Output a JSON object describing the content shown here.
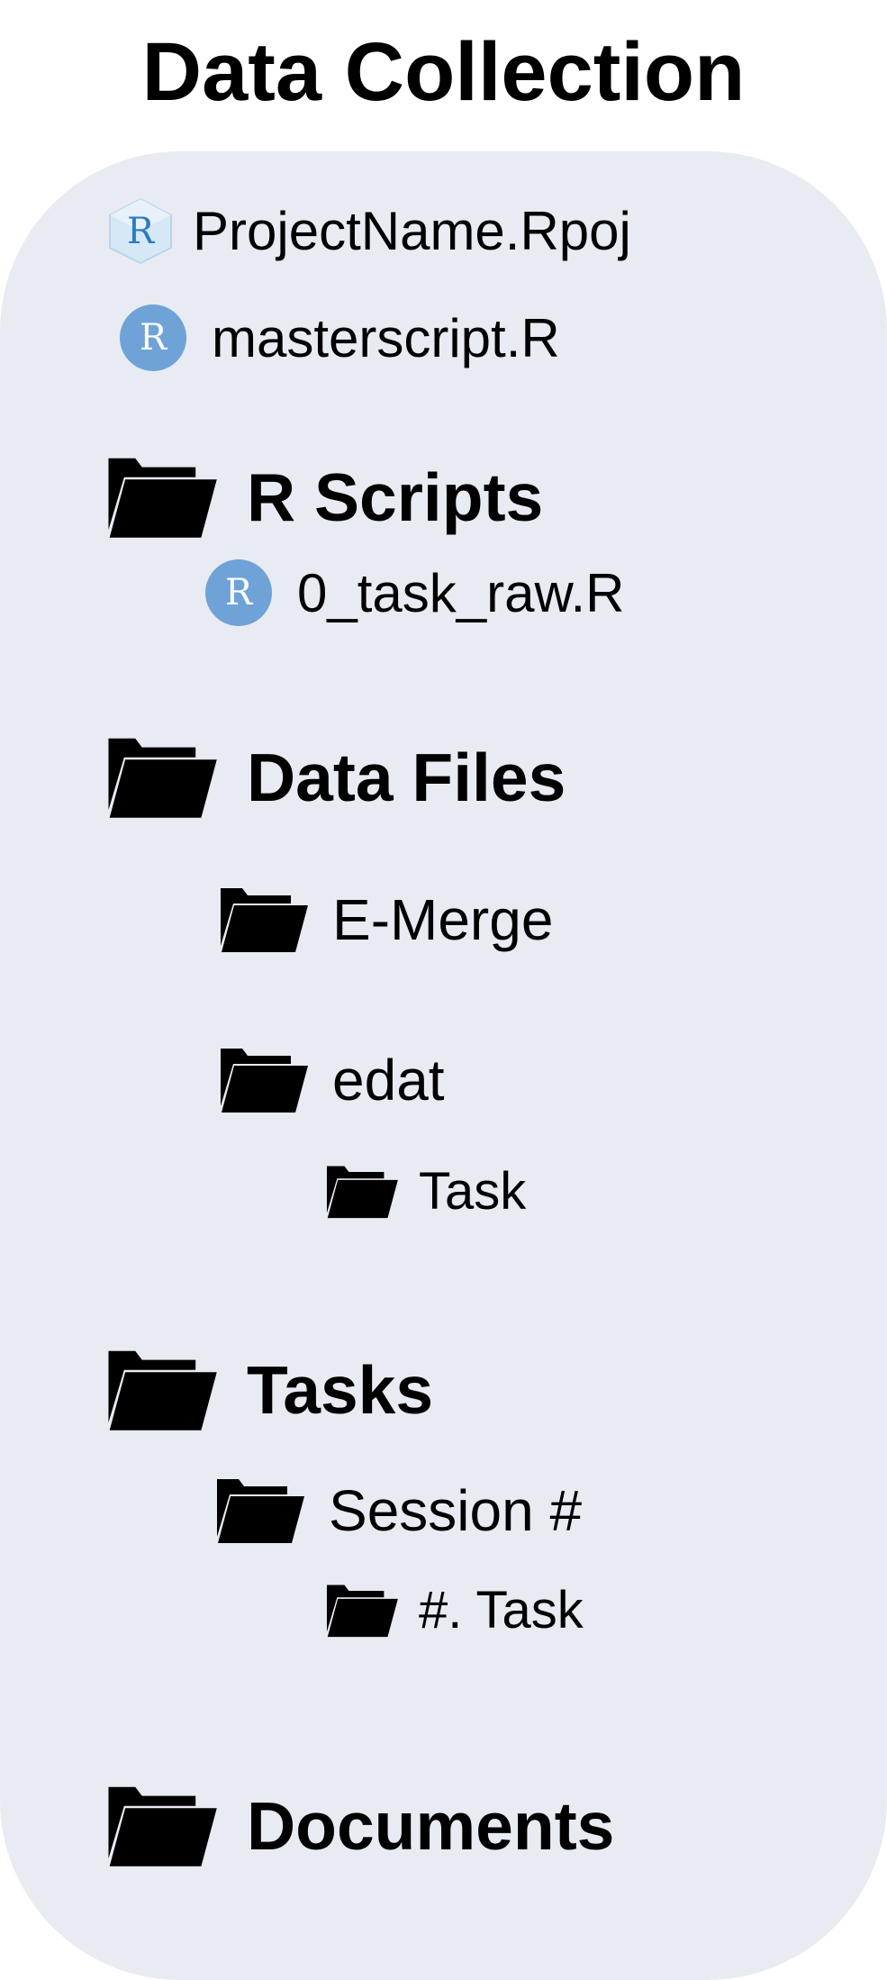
{
  "title": "Data Collection",
  "colors": {
    "panel": "#E8EBF1",
    "r_circle": "#6FA3D8",
    "r_proj_cube": "#CFE3F3",
    "r_proj_letter": "#2C7BC0",
    "text": "#000000"
  },
  "tree": {
    "project_file": {
      "label": "ProjectName.Rpoj",
      "icon": "rproject-icon"
    },
    "master_script": {
      "label": "masterscript.R",
      "icon": "r-file-icon"
    },
    "r_scripts": {
      "label": "R Scripts",
      "icon": "folder-open-icon",
      "files": [
        {
          "label": "0_task_raw.R",
          "icon": "r-file-icon"
        }
      ]
    },
    "data_files": {
      "label": "Data Files",
      "icon": "folder-open-icon",
      "emerge": {
        "label": "E-Merge",
        "icon": "folder-open-icon"
      },
      "edat": {
        "label": "edat",
        "icon": "folder-open-icon",
        "task": {
          "label": "Task",
          "icon": "folder-open-icon"
        }
      }
    },
    "tasks": {
      "label": "Tasks",
      "icon": "folder-open-icon",
      "session": {
        "label": "Session #",
        "icon": "folder-open-icon",
        "task": {
          "label": "#. Task",
          "icon": "folder-open-icon"
        }
      }
    },
    "documents": {
      "label": "Documents",
      "icon": "folder-open-icon"
    }
  }
}
